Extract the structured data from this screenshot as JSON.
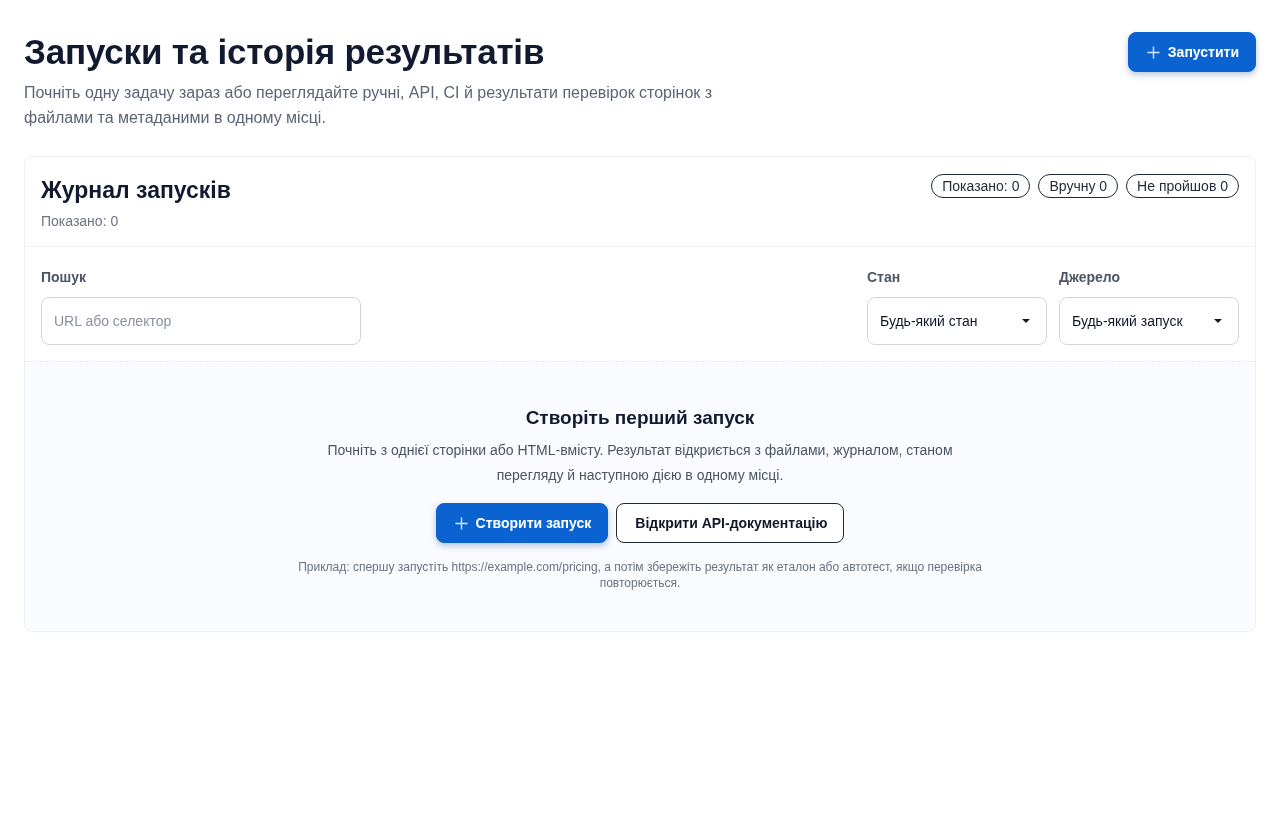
{
  "header": {
    "title": "Запуски та історія результатів",
    "subtitle": "Почніть одну задачу зараз або переглядайте ручні, API, CI й результати перевірок сторінок з файлами та метаданими в одному місці.",
    "primary_action": {
      "label": "Запустити"
    }
  },
  "runs_panel": {
    "title": "Журнал запусків",
    "count": "Показано: 0",
    "badges": [
      "Показано: 0",
      "Вручну 0",
      "Не пройшов 0"
    ],
    "filters": {
      "search": {
        "label": "Пошук",
        "placeholder": "URL або селектор"
      },
      "selects": [
        {
          "label": "Стан",
          "value": "Будь-який стан"
        },
        {
          "label": "Джерело",
          "value": "Будь-який запуск"
        }
      ]
    },
    "empty_state": {
      "title": "Створіть перший запуск",
      "text": "Почніть з однієї сторінки або HTML-вмісту. Результат відкриється з файлами, журналом, станом перегляду й наступною дією в одному місці.",
      "actions": [
        {
          "label": "Створити запуск",
          "kind": "primary"
        },
        {
          "label": "Відкрити API-документацію",
          "kind": "secondary"
        }
      ],
      "hint": "Приклад: спершу запустіть https://example.com/pricing, а потім збережіть результат як еталон або автотест, якщо перевірка повторюється."
    }
  }
}
